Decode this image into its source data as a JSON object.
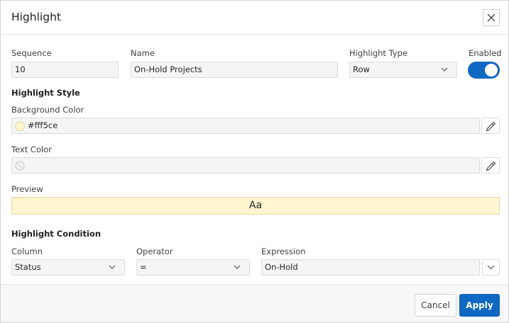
{
  "dialog": {
    "title": "Highlight",
    "close_icon": "close-icon"
  },
  "fields": {
    "sequence": {
      "label": "Sequence",
      "value": "10"
    },
    "name": {
      "label": "Name",
      "value": "On-Hold Projects"
    },
    "highlight_type": {
      "label": "Highlight Type",
      "value": "Row"
    },
    "enabled": {
      "label": "Enabled",
      "on": true
    }
  },
  "highlight_style": {
    "title": "Highlight Style",
    "background_color": {
      "label": "Background Color",
      "value": "#fff5ce"
    },
    "text_color": {
      "label": "Text Color",
      "value": ""
    },
    "preview": {
      "label": "Preview",
      "text": "Aa",
      "color": "#fff5ce"
    }
  },
  "highlight_condition": {
    "title": "Highlight Condition",
    "column": {
      "label": "Column",
      "value": "Status"
    },
    "operator": {
      "label": "Operator",
      "value": "="
    },
    "expression": {
      "label": "Expression",
      "value": "On-Hold"
    }
  },
  "buttons": {
    "cancel": "Cancel",
    "apply": "Apply"
  },
  "colors": {
    "accent": "#0f68c2",
    "highlight": "#fff5ce"
  }
}
